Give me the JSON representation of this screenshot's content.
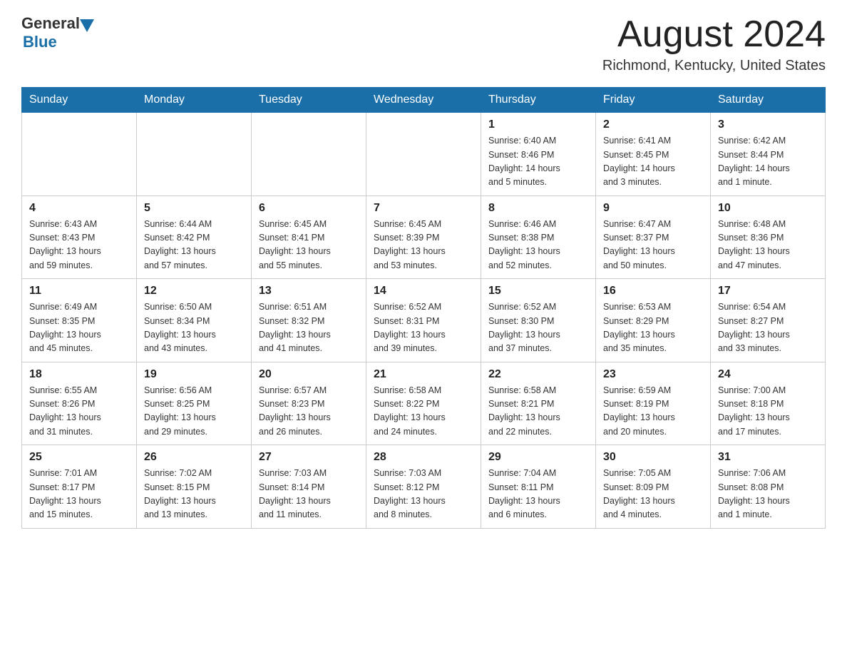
{
  "header": {
    "logo_general": "General",
    "logo_blue": "Blue",
    "month_title": "August 2024",
    "location": "Richmond, Kentucky, United States"
  },
  "days_of_week": [
    "Sunday",
    "Monday",
    "Tuesday",
    "Wednesday",
    "Thursday",
    "Friday",
    "Saturday"
  ],
  "weeks": [
    [
      {
        "day": "",
        "info": ""
      },
      {
        "day": "",
        "info": ""
      },
      {
        "day": "",
        "info": ""
      },
      {
        "day": "",
        "info": ""
      },
      {
        "day": "1",
        "info": "Sunrise: 6:40 AM\nSunset: 8:46 PM\nDaylight: 14 hours\nand 5 minutes."
      },
      {
        "day": "2",
        "info": "Sunrise: 6:41 AM\nSunset: 8:45 PM\nDaylight: 14 hours\nand 3 minutes."
      },
      {
        "day": "3",
        "info": "Sunrise: 6:42 AM\nSunset: 8:44 PM\nDaylight: 14 hours\nand 1 minute."
      }
    ],
    [
      {
        "day": "4",
        "info": "Sunrise: 6:43 AM\nSunset: 8:43 PM\nDaylight: 13 hours\nand 59 minutes."
      },
      {
        "day": "5",
        "info": "Sunrise: 6:44 AM\nSunset: 8:42 PM\nDaylight: 13 hours\nand 57 minutes."
      },
      {
        "day": "6",
        "info": "Sunrise: 6:45 AM\nSunset: 8:41 PM\nDaylight: 13 hours\nand 55 minutes."
      },
      {
        "day": "7",
        "info": "Sunrise: 6:45 AM\nSunset: 8:39 PM\nDaylight: 13 hours\nand 53 minutes."
      },
      {
        "day": "8",
        "info": "Sunrise: 6:46 AM\nSunset: 8:38 PM\nDaylight: 13 hours\nand 52 minutes."
      },
      {
        "day": "9",
        "info": "Sunrise: 6:47 AM\nSunset: 8:37 PM\nDaylight: 13 hours\nand 50 minutes."
      },
      {
        "day": "10",
        "info": "Sunrise: 6:48 AM\nSunset: 8:36 PM\nDaylight: 13 hours\nand 47 minutes."
      }
    ],
    [
      {
        "day": "11",
        "info": "Sunrise: 6:49 AM\nSunset: 8:35 PM\nDaylight: 13 hours\nand 45 minutes."
      },
      {
        "day": "12",
        "info": "Sunrise: 6:50 AM\nSunset: 8:34 PM\nDaylight: 13 hours\nand 43 minutes."
      },
      {
        "day": "13",
        "info": "Sunrise: 6:51 AM\nSunset: 8:32 PM\nDaylight: 13 hours\nand 41 minutes."
      },
      {
        "day": "14",
        "info": "Sunrise: 6:52 AM\nSunset: 8:31 PM\nDaylight: 13 hours\nand 39 minutes."
      },
      {
        "day": "15",
        "info": "Sunrise: 6:52 AM\nSunset: 8:30 PM\nDaylight: 13 hours\nand 37 minutes."
      },
      {
        "day": "16",
        "info": "Sunrise: 6:53 AM\nSunset: 8:29 PM\nDaylight: 13 hours\nand 35 minutes."
      },
      {
        "day": "17",
        "info": "Sunrise: 6:54 AM\nSunset: 8:27 PM\nDaylight: 13 hours\nand 33 minutes."
      }
    ],
    [
      {
        "day": "18",
        "info": "Sunrise: 6:55 AM\nSunset: 8:26 PM\nDaylight: 13 hours\nand 31 minutes."
      },
      {
        "day": "19",
        "info": "Sunrise: 6:56 AM\nSunset: 8:25 PM\nDaylight: 13 hours\nand 29 minutes."
      },
      {
        "day": "20",
        "info": "Sunrise: 6:57 AM\nSunset: 8:23 PM\nDaylight: 13 hours\nand 26 minutes."
      },
      {
        "day": "21",
        "info": "Sunrise: 6:58 AM\nSunset: 8:22 PM\nDaylight: 13 hours\nand 24 minutes."
      },
      {
        "day": "22",
        "info": "Sunrise: 6:58 AM\nSunset: 8:21 PM\nDaylight: 13 hours\nand 22 minutes."
      },
      {
        "day": "23",
        "info": "Sunrise: 6:59 AM\nSunset: 8:19 PM\nDaylight: 13 hours\nand 20 minutes."
      },
      {
        "day": "24",
        "info": "Sunrise: 7:00 AM\nSunset: 8:18 PM\nDaylight: 13 hours\nand 17 minutes."
      }
    ],
    [
      {
        "day": "25",
        "info": "Sunrise: 7:01 AM\nSunset: 8:17 PM\nDaylight: 13 hours\nand 15 minutes."
      },
      {
        "day": "26",
        "info": "Sunrise: 7:02 AM\nSunset: 8:15 PM\nDaylight: 13 hours\nand 13 minutes."
      },
      {
        "day": "27",
        "info": "Sunrise: 7:03 AM\nSunset: 8:14 PM\nDaylight: 13 hours\nand 11 minutes."
      },
      {
        "day": "28",
        "info": "Sunrise: 7:03 AM\nSunset: 8:12 PM\nDaylight: 13 hours\nand 8 minutes."
      },
      {
        "day": "29",
        "info": "Sunrise: 7:04 AM\nSunset: 8:11 PM\nDaylight: 13 hours\nand 6 minutes."
      },
      {
        "day": "30",
        "info": "Sunrise: 7:05 AM\nSunset: 8:09 PM\nDaylight: 13 hours\nand 4 minutes."
      },
      {
        "day": "31",
        "info": "Sunrise: 7:06 AM\nSunset: 8:08 PM\nDaylight: 13 hours\nand 1 minute."
      }
    ]
  ]
}
